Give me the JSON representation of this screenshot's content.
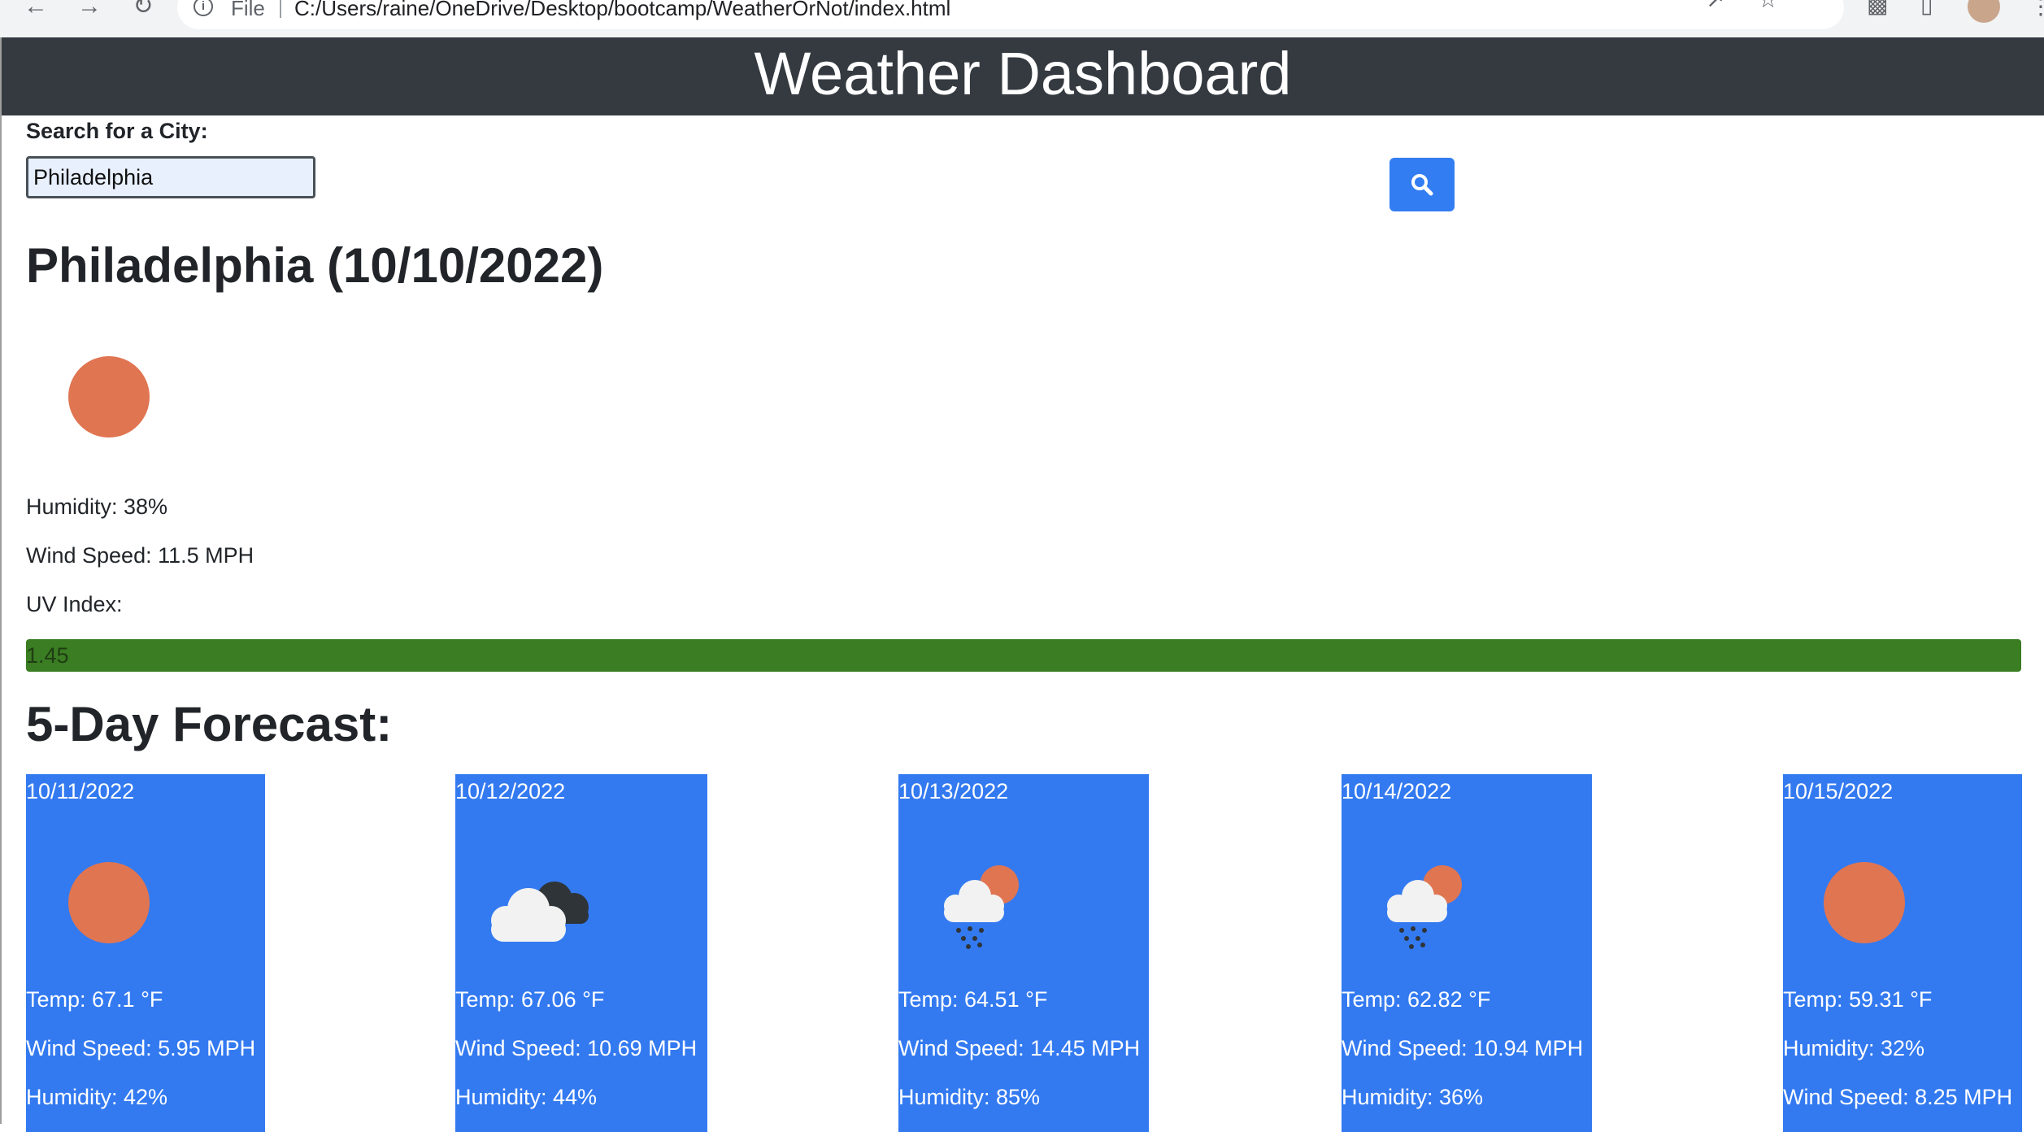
{
  "browser": {
    "file_label": "File",
    "url": "C:/Users/raine/OneDrive/Desktop/bootcamp/WeatherOrNot/index.html"
  },
  "header": {
    "title": "Weather Dashboard"
  },
  "search": {
    "label": "Search for a City:",
    "value": "Philadelphia"
  },
  "current": {
    "title": "Philadelphia (10/10/2022)",
    "icon": "sun-icon",
    "humidity": "Humidity: 38%",
    "wind": "Wind Speed: 11.5 MPH",
    "uv_label": "UV Index:",
    "uv_value": "1.45",
    "uv_color": "#3a7d22"
  },
  "forecast": {
    "title": "5-Day Forecast:",
    "days": [
      {
        "date": "10/11/2022",
        "icon": "sun-icon",
        "line1": "Temp: 67.1 °F",
        "line2": "Wind Speed: 5.95 MPH",
        "line3": "Humidity: 42%"
      },
      {
        "date": "10/12/2022",
        "icon": "cloudy-icon",
        "line1": "Temp: 67.06 °F",
        "line2": "Wind Speed: 10.69 MPH",
        "line3": "Humidity: 44%"
      },
      {
        "date": "10/13/2022",
        "icon": "rain-sun-icon",
        "line1": "Temp: 64.51 °F",
        "line2": "Wind Speed: 14.45 MPH",
        "line3": "Humidity: 85%"
      },
      {
        "date": "10/14/2022",
        "icon": "rain-sun-icon",
        "line1": "Temp: 62.82 °F",
        "line2": "Wind Speed: 10.94 MPH",
        "line3": "Humidity: 36%"
      },
      {
        "date": "10/15/2022",
        "icon": "sun-icon",
        "line1": "Temp: 59.31 °F",
        "line2": "Humidity: 32%",
        "line3": "Wind Speed: 8.25 MPH"
      }
    ]
  },
  "colors": {
    "header_bg": "#343a40",
    "card_bg": "#337af1",
    "button_bg": "#337df2",
    "sun": "#e07552"
  }
}
